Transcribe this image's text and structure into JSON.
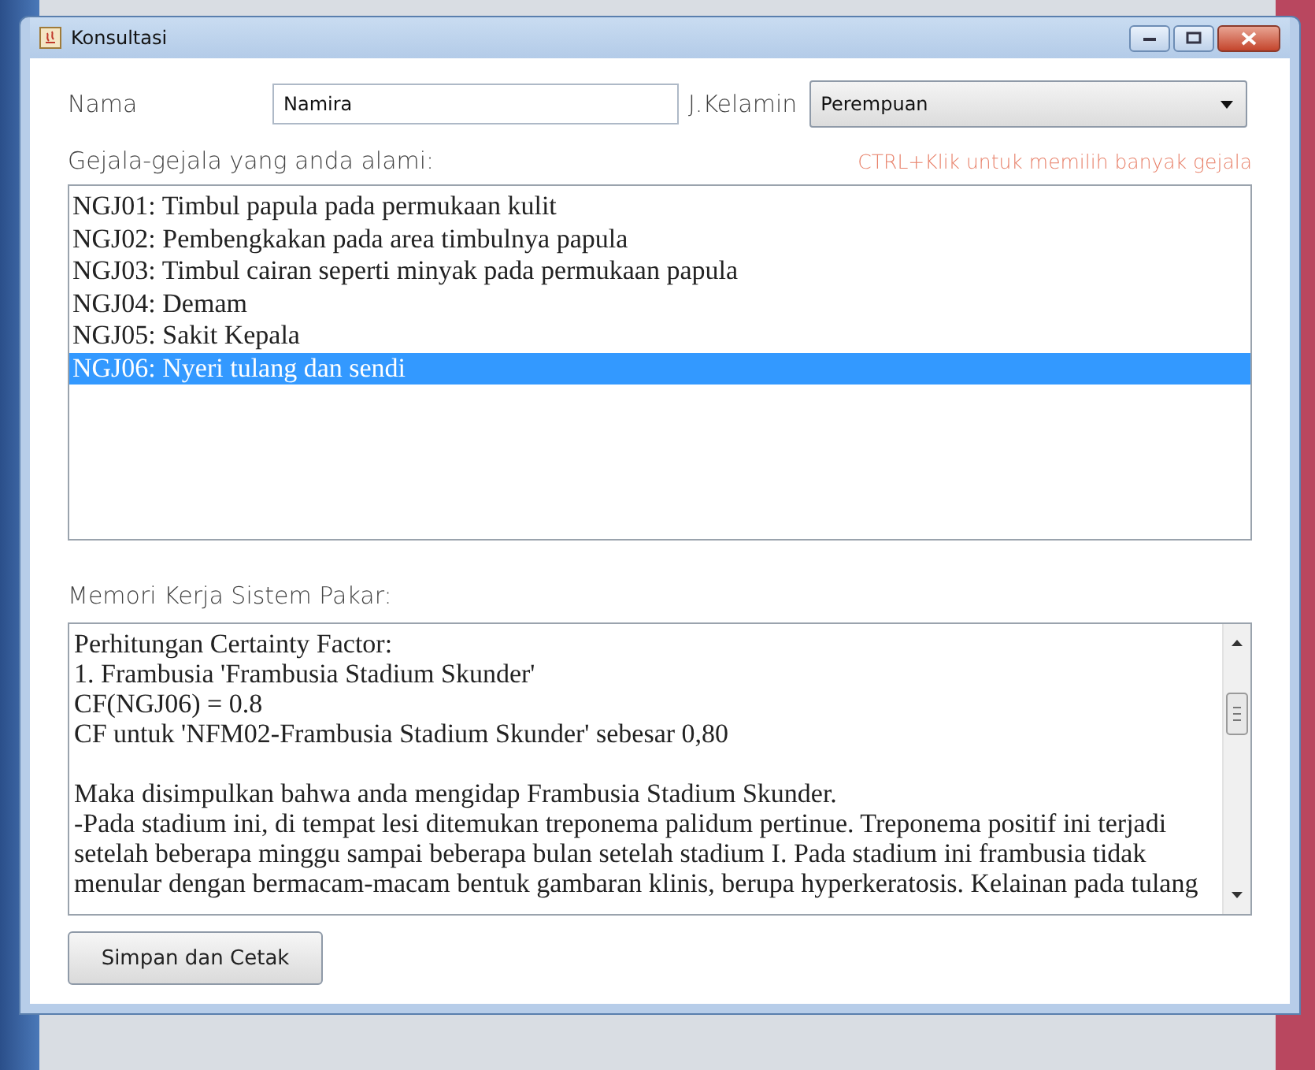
{
  "window": {
    "title": "Konsultasi"
  },
  "form": {
    "name_label": "Nama",
    "name_value": "Namira",
    "gender_label": "J.Kelamin",
    "gender_value": "Perempuan"
  },
  "symptoms": {
    "label": "Gejala-gejala yang anda alami:",
    "hint": "CTRL+Klik untuk memilih banyak gejala",
    "items": [
      {
        "text": "NGJ01: Timbul papula pada permukaan kulit",
        "selected": false
      },
      {
        "text": "NGJ02: Pembengkakan pada area timbulnya papula",
        "selected": false
      },
      {
        "text": "NGJ03: Timbul cairan seperti minyak pada permukaan papula",
        "selected": false
      },
      {
        "text": "NGJ04: Demam",
        "selected": false
      },
      {
        "text": "NGJ05: Sakit Kepala",
        "selected": false
      },
      {
        "text": "NGJ06: Nyeri tulang dan sendi",
        "selected": true
      }
    ]
  },
  "memory": {
    "label": "Memori Kerja Sistem Pakar:",
    "paragraphs": [
      {
        "lines": [
          "Perhitungan Certainty Factor:",
          "1. Frambusia 'Frambusia Stadium Skunder'",
          "CF(NGJ06) = 0.8",
          "CF untuk 'NFM02-Frambusia Stadium Skunder' sebesar 0,80"
        ]
      },
      {
        "lines": [
          "Maka disimpulkan bahwa anda mengidap Frambusia Stadium Skunder.",
          "-Pada stadium ini, di tempat lesi ditemukan treponema palidum pertinue. Treponema positif ini terjadi",
          "setelah beberapa minggu sampai beberapa bulan setelah stadium I. Pada stadium ini frambusia tidak",
          "menular dengan bermacam-macam bentuk gambaran klinis, berupa hyperkeratosis. Kelainan pada tulang"
        ]
      }
    ]
  },
  "buttons": [
    "Simpan dan Cetak"
  ]
}
